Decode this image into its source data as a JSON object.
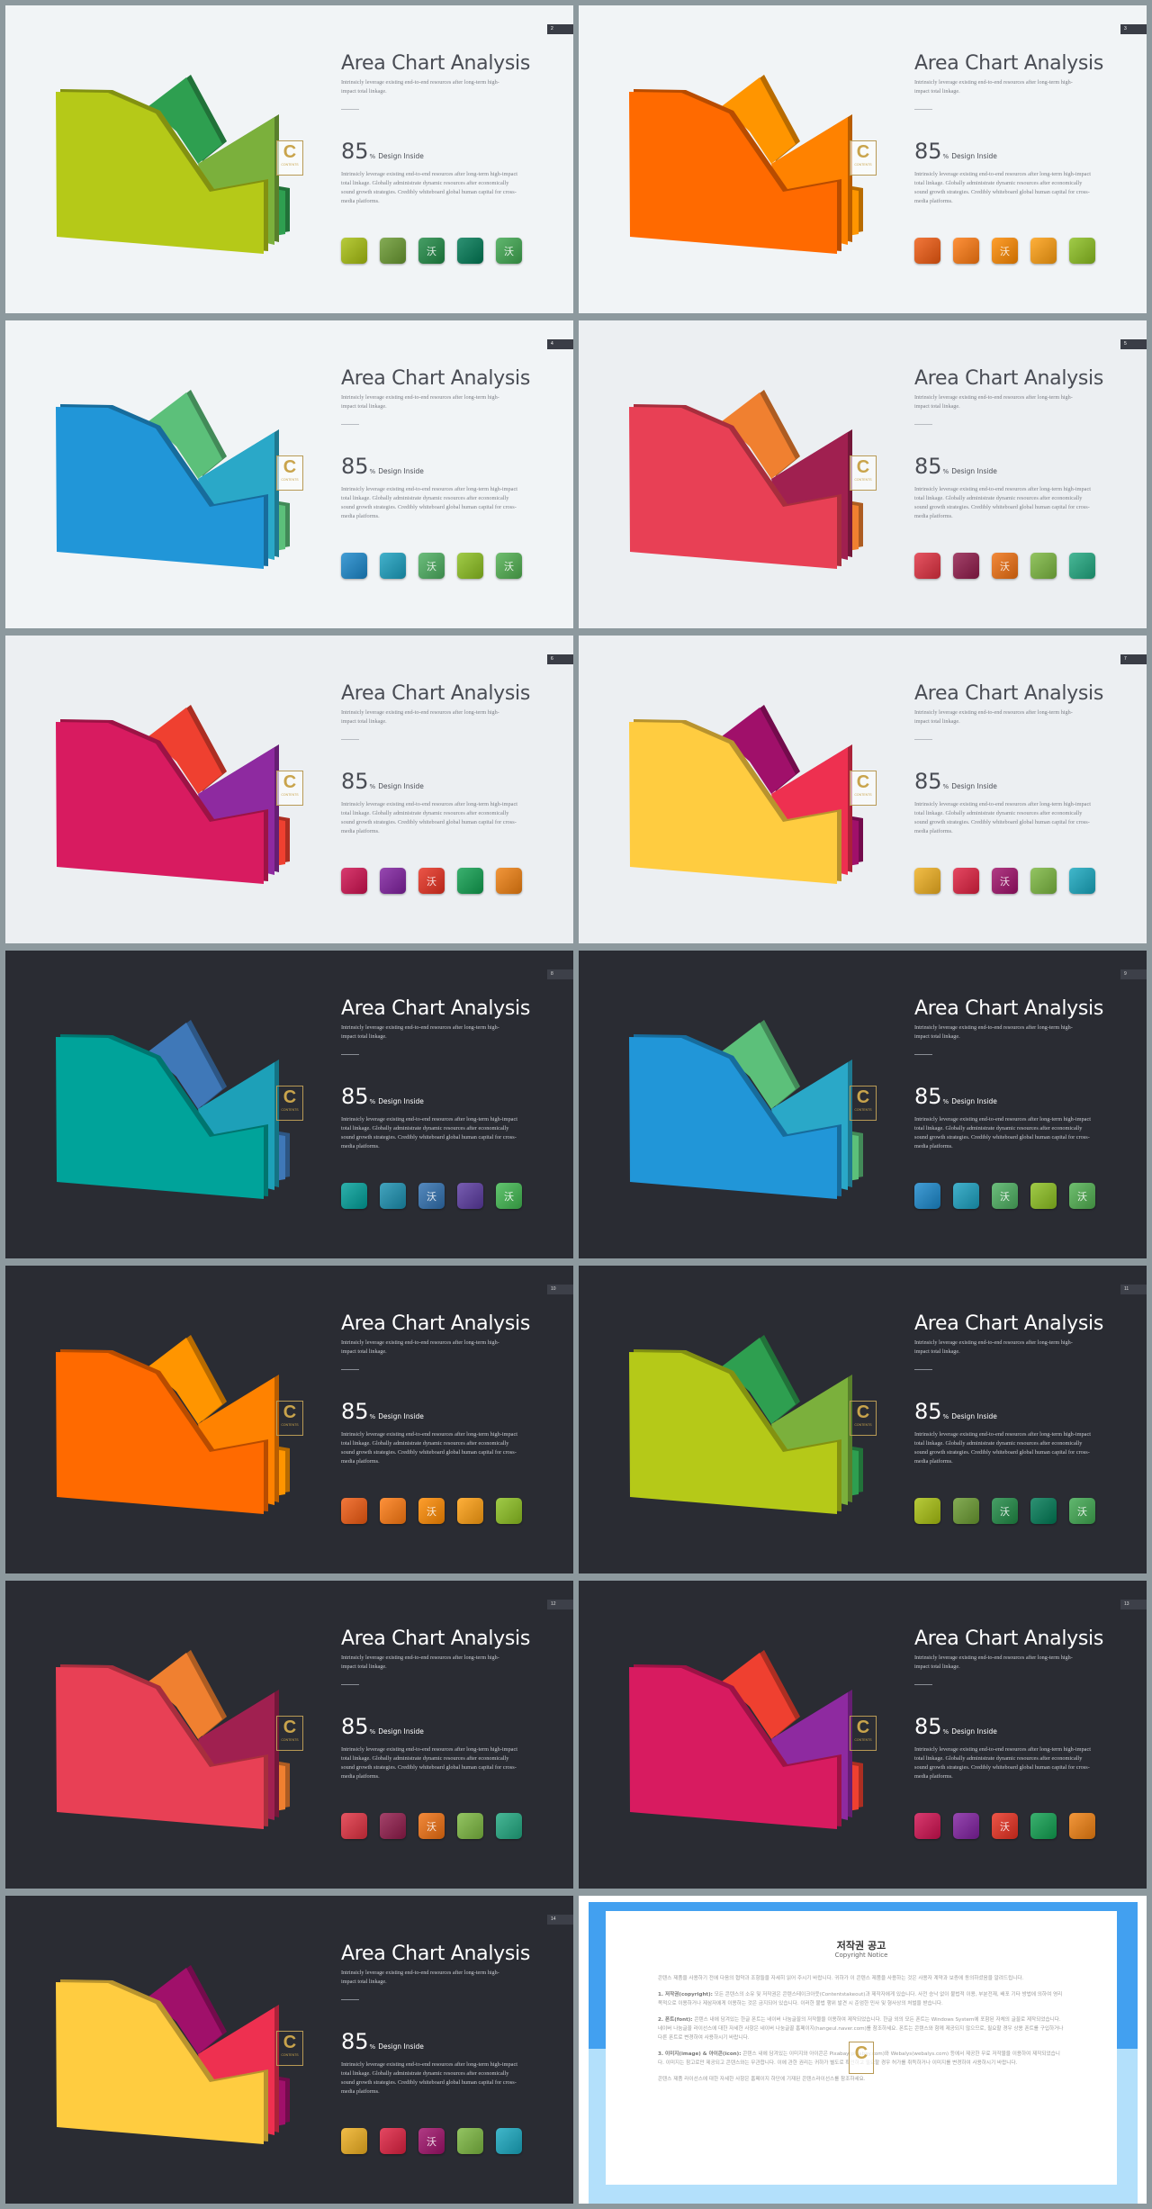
{
  "slide_text": {
    "title": "Area Chart Analysis",
    "subtitle": "Intrinsicly leverage existing end-to-end resources after long-term high-impact total linkage.",
    "stat_value": "85",
    "stat_unit": "%",
    "stat_label": "Design Inside",
    "paragraph": "Intrinsicly leverage existing end-to-end resources after long-term high-impact total linkage. Globally administrate dynamic resources after economically sound growth strategies. Credibly whiteboard global human capital for cross-media platforms.",
    "swatch_glyph": "沃",
    "logo_letter": "C",
    "logo_text": "CONTENTS"
  },
  "slides": [
    {
      "page": "2",
      "theme": "light",
      "colors": {
        "front": "#b5c918",
        "back1": "#2e9f50",
        "back2": "#7bb03c",
        "small": "#2e9f50"
      },
      "swatches": [
        "#a8c010",
        "#6a9a30",
        "#1f8a45",
        "#007a55",
        "#3fa850"
      ],
      "glyph_on": [
        2,
        4
      ]
    },
    {
      "page": "3",
      "theme": "light",
      "colors": {
        "front": "#ff6a00",
        "back1": "#ff9500",
        "back2": "#ff8200",
        "small": "#ff9500"
      },
      "swatches": [
        "#f05a10",
        "#ff7a10",
        "#ff8a00",
        "#ff9f10",
        "#8cc020"
      ],
      "glyph_on": [
        2
      ]
    },
    {
      "page": "4",
      "theme": "light",
      "colors": {
        "front": "#2196d8",
        "back1": "#5cc07a",
        "back2": "#2aa8c8",
        "small": "#5cc07a"
      },
      "swatches": [
        "#1a88cc",
        "#1aa0c0",
        "#4caf60",
        "#8cc020",
        "#50b050"
      ],
      "glyph_on": [
        2,
        4
      ]
    },
    {
      "page": "5",
      "theme": "light2",
      "colors": {
        "front": "#e84055",
        "back1": "#f08030",
        "back2": "#a02050",
        "small": "#f08030"
      },
      "swatches": [
        "#e03040",
        "#901a4a",
        "#f07010",
        "#7cb840",
        "#20a880"
      ],
      "glyph_on": [
        2
      ]
    },
    {
      "page": "6",
      "theme": "light2",
      "colors": {
        "front": "#d81b60",
        "back1": "#ef4030",
        "back2": "#8e2aa0",
        "small": "#ef4030"
      },
      "swatches": [
        "#d01050",
        "#8020a0",
        "#e83020",
        "#10a050",
        "#f08010"
      ],
      "glyph_on": [
        2
      ]
    },
    {
      "page": "7",
      "theme": "light2",
      "colors": {
        "front": "#ffcc40",
        "back1": "#a0106a",
        "back2": "#ee3050",
        "small": "#a0106a"
      },
      "swatches": [
        "#f0b020",
        "#e02040",
        "#a0106a",
        "#7cb840",
        "#18a8c0"
      ],
      "glyph_on": [
        2
      ]
    },
    {
      "page": "8",
      "theme": "dark",
      "colors": {
        "front": "#00a39a",
        "back1": "#3f78b8",
        "back2": "#1da0b8",
        "small": "#3f78b8"
      },
      "swatches": [
        "#00a09a",
        "#1a90b0",
        "#3070b0",
        "#5a3aa0",
        "#40b850"
      ],
      "glyph_on": [
        2,
        4
      ]
    },
    {
      "page": "9",
      "theme": "dark",
      "colors": {
        "front": "#2196d8",
        "back1": "#5cc07a",
        "back2": "#2aa8c8",
        "small": "#5cc07a"
      },
      "swatches": [
        "#1a88cc",
        "#1aa0c0",
        "#4caf60",
        "#8cc020",
        "#50b050"
      ],
      "glyph_on": [
        2,
        4
      ]
    },
    {
      "page": "10",
      "theme": "dark",
      "colors": {
        "front": "#ff6a00",
        "back1": "#ff9500",
        "back2": "#ff8200",
        "small": "#ff9500"
      },
      "swatches": [
        "#f05a10",
        "#ff7a10",
        "#ff8a00",
        "#ff9f10",
        "#8cc020"
      ],
      "glyph_on": [
        2
      ]
    },
    {
      "page": "11",
      "theme": "dark",
      "colors": {
        "front": "#b5c918",
        "back1": "#2e9f50",
        "back2": "#7bb03c",
        "small": "#2e9f50"
      },
      "swatches": [
        "#a8c010",
        "#6a9a30",
        "#1f8a45",
        "#007a55",
        "#3fa850"
      ],
      "glyph_on": [
        2,
        4
      ]
    },
    {
      "page": "12",
      "theme": "dark",
      "colors": {
        "front": "#e84055",
        "back1": "#f08030",
        "back2": "#a02050",
        "small": "#f08030"
      },
      "swatches": [
        "#e03040",
        "#901a4a",
        "#f07010",
        "#7cb840",
        "#20a880"
      ],
      "glyph_on": [
        2
      ]
    },
    {
      "page": "13",
      "theme": "dark",
      "colors": {
        "front": "#d81b60",
        "back1": "#ef4030",
        "back2": "#8e2aa0",
        "small": "#ef4030"
      },
      "swatches": [
        "#d01050",
        "#8020a0",
        "#e83020",
        "#10a050",
        "#f08010"
      ],
      "glyph_on": [
        2
      ]
    },
    {
      "page": "14",
      "theme": "dark",
      "colors": {
        "front": "#ffcc40",
        "back1": "#a0106a",
        "back2": "#ee3050",
        "small": "#a0106a"
      },
      "swatches": [
        "#f0b020",
        "#e02040",
        "#a0106a",
        "#7cb840",
        "#18a8c0"
      ],
      "glyph_on": [
        2
      ]
    }
  ],
  "copyright": {
    "title": "저작권 공고",
    "subtitle": "Copyright Notice",
    "intro": "콘텐스 제품을 사용하기 전에 다음의 협약과 조항들을 자세히 읽어 주시기 바랍니다. 귀하가 이 콘텐스 제품을 사용하는 것은 사용자 계약과 보증에 동의하셨음을 알려드립니다.",
    "items": [
      {
        "head": "1. 저작권(copyright):",
        "text": "모든 콘텐스의 소유 및 저작권은 콘텐스테이크아웃(Contentstakeout)과 제작자에게 있습니다. 사전 승낙 없이 불법적 이용, 부분전재, 배포 기타 방법에 의하여 영리 목적으로 이용하거나 제삼자에게 이용하는 것은 금지되어 있습니다. 이러한 불법 행위 발견 시 준엄한 민사 및 형사상의 처벌을 받습니다."
      },
      {
        "head": "2. 폰트(font):",
        "text": "콘텐스 내에 담겨있는 한글 폰트는 네이버 나눔글꼴의 저작물을 이용하여 제작되었습니다. 한글 외의 모든 폰트는 Windows System에 포함된 자체의 글꼴로 제작되었습니다. 네이버 나눔글꼴 라이선스에 대한 자세한 사항은 네이버 나눔글꼴 홈페이지(hangeul.naver.com)를 참조하세요. 폰트는 콘텐스와 함께 제공되지 않으므로, 필요할 경우 상용 폰트를 구입하거나 다른 폰트로 변경하여 사용하시기 바랍니다."
      },
      {
        "head": "3. 이미지(image) & 아이콘(icon):",
        "text": "콘텐스 내에 담겨있는 이미지와 아이콘은 Pixabay(pixabay.com)와 Webalys(webalys.com) 등에서 제공한 무료 저작물을 이용하여 제작되었습니다. 이미지는 참고로만 제공되고 콘텐스와는 무관합니다. 이에 관한 권리는 귀하가 별도로 확인하고 필요할 경우 허가를 취득하거나 이미지를 변경하여 사용하시기 바랍니다."
      }
    ],
    "footer": "콘텐스 제품 라이선스에 대한 자세한 사항은 홈페이지 하단에 기재된 콘텐스라이선스를 참조하세요."
  }
}
